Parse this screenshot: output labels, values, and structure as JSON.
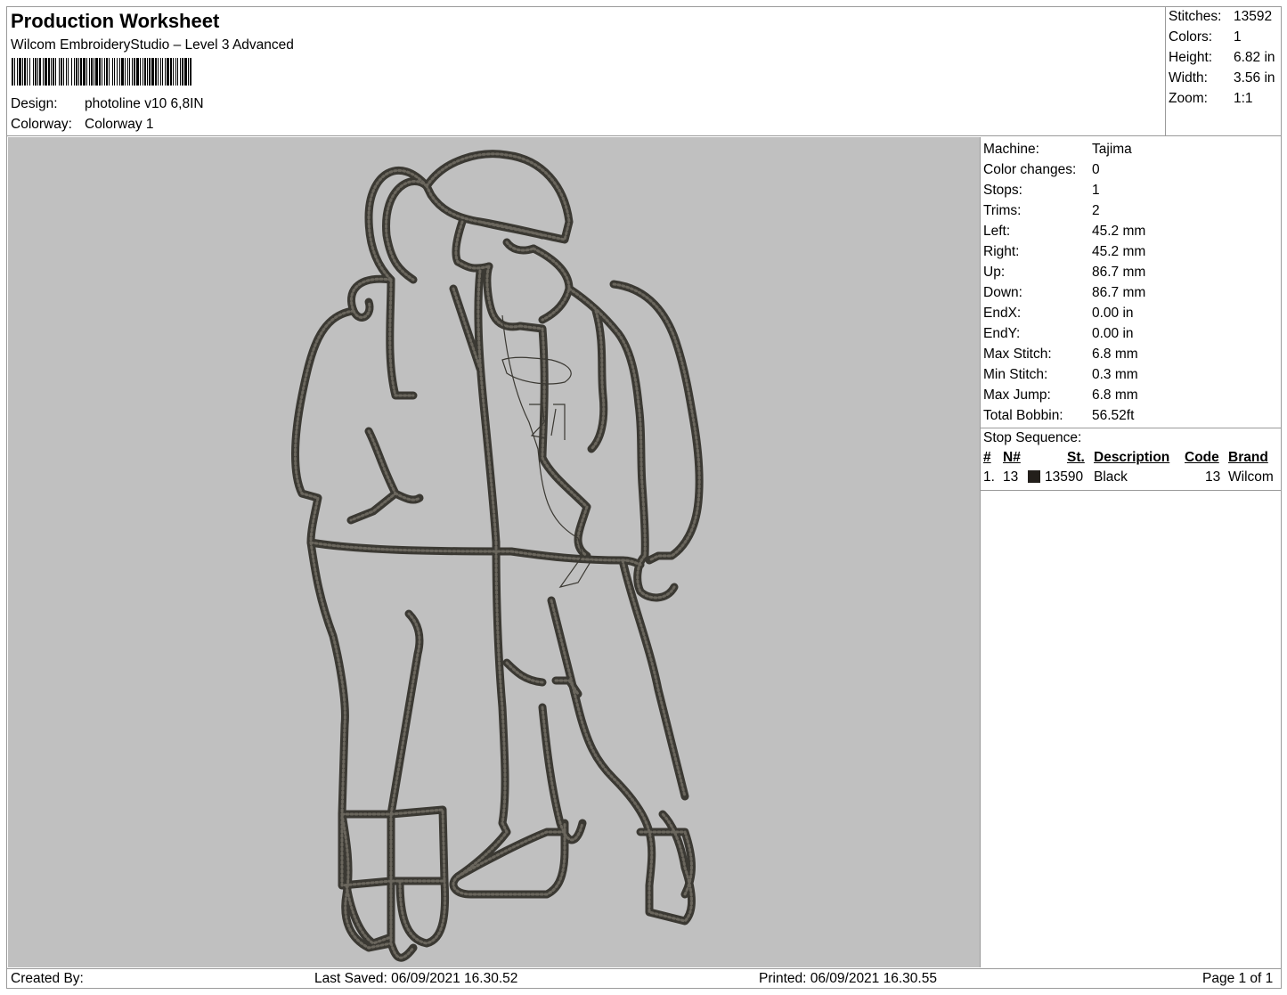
{
  "header": {
    "title": "Production Worksheet",
    "subtitle": "Wilcom EmbroideryStudio – Level 3 Advanced",
    "design_label": "Design:",
    "design_value": "photoline v10 6,8IN",
    "colorway_label": "Colorway:",
    "colorway_value": "Colorway 1"
  },
  "stats": [
    {
      "label": "Stitches:",
      "value": "13592"
    },
    {
      "label": "Colors:",
      "value": "1"
    },
    {
      "label": "Height:",
      "value": "6.82 in"
    },
    {
      "label": "Width:",
      "value": "3.56 in"
    },
    {
      "label": "Zoom:",
      "value": "1:1"
    }
  ],
  "machine": [
    {
      "label": "Machine:",
      "value": "Tajima"
    },
    {
      "label": "Color changes:",
      "value": "0"
    },
    {
      "label": "Stops:",
      "value": "1"
    },
    {
      "label": "Trims:",
      "value": "2"
    },
    {
      "label": "Left:",
      "value": "45.2 mm"
    },
    {
      "label": "Right:",
      "value": "45.2 mm"
    },
    {
      "label": "Up:",
      "value": "86.7 mm"
    },
    {
      "label": "Down:",
      "value": "86.7 mm"
    },
    {
      "label": "EndX:",
      "value": "0.00 in"
    },
    {
      "label": "EndY:",
      "value": "0.00 in"
    },
    {
      "label": "Max Stitch:",
      "value": "6.8 mm"
    },
    {
      "label": "Min Stitch:",
      "value": "0.3 mm"
    },
    {
      "label": "Max Jump:",
      "value": "6.8 mm"
    },
    {
      "label": "Total Bobbin:",
      "value": "56.52ft"
    }
  ],
  "stop_sequence": {
    "label": "Stop Sequence:",
    "headers": {
      "num": "#",
      "n": "N#",
      "st": "St.",
      "description": "Description",
      "code": "Code",
      "brand": "Brand"
    },
    "rows": [
      {
        "num": "1.",
        "n": "13",
        "swatch_color": "#231f1b",
        "st": "13590",
        "description": "Black",
        "code": "13",
        "brand": "Wilcom"
      }
    ]
  },
  "design_canvas": {
    "background": "#c0c0c0",
    "thread_color": "#3b3933"
  },
  "footer": {
    "created_by": "Created By:",
    "last_saved": "Last Saved: 06/09/2021 16.30.52",
    "printed": "Printed: 06/09/2021 16.30.55",
    "page": "Page 1 of 1"
  }
}
